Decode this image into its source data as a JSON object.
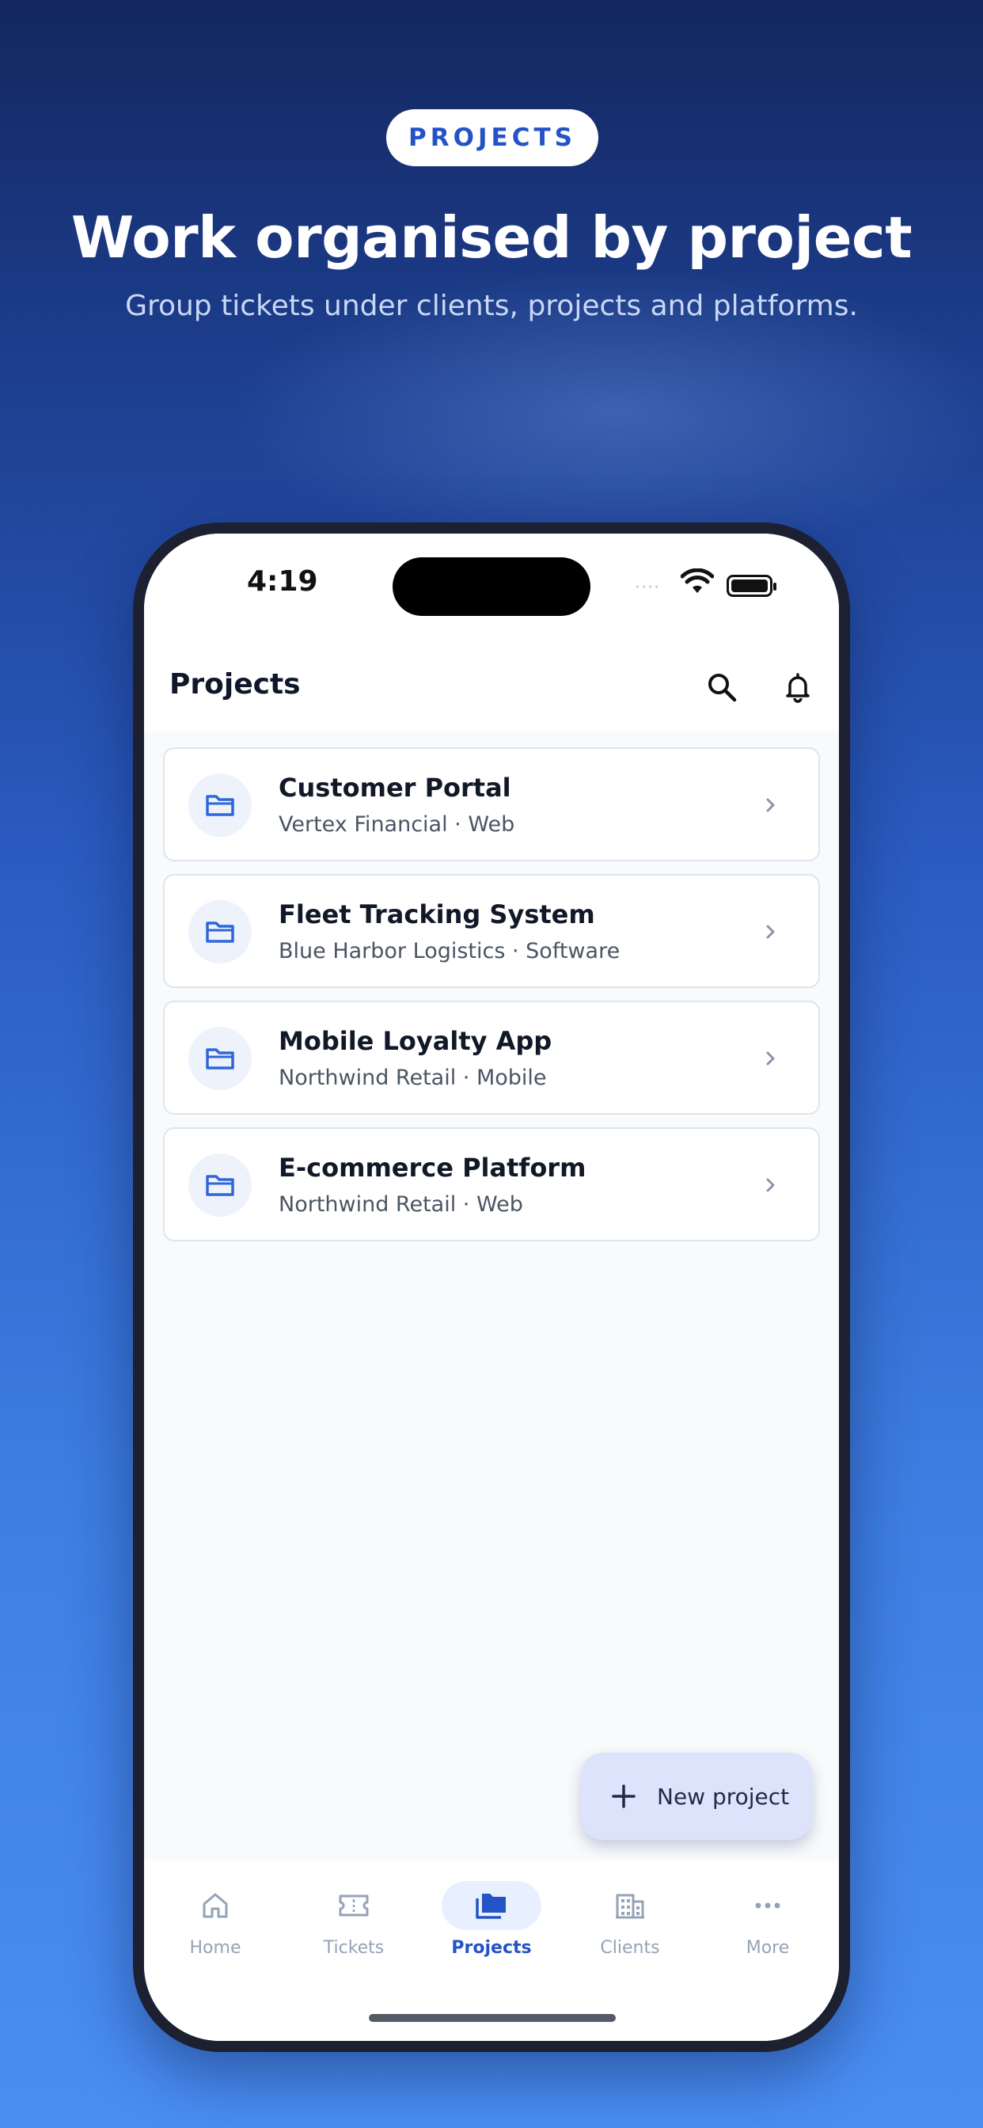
{
  "promo": {
    "badge": "PROJECTS",
    "headline": "Work organised by project",
    "subhead": "Group tickets under clients, projects and platforms."
  },
  "status_bar": {
    "time": "4:19",
    "signal": "····"
  },
  "app_bar": {
    "title": "Projects",
    "icons": [
      "search-icon",
      "bell-icon"
    ]
  },
  "projects": [
    {
      "name": "Customer Portal",
      "meta": "Vertex Financial · Web"
    },
    {
      "name": "Fleet Tracking System",
      "meta": "Blue Harbor Logistics · Software"
    },
    {
      "name": "Mobile Loyalty App",
      "meta": "Northwind Retail · Mobile"
    },
    {
      "name": "E-commerce Platform",
      "meta": "Northwind Retail · Web"
    }
  ],
  "fab": {
    "label": "New project"
  },
  "tabs": [
    {
      "label": "Home",
      "icon": "home-icon"
    },
    {
      "label": "Tickets",
      "icon": "ticket-icon"
    },
    {
      "label": "Projects",
      "icon": "folder-stack-icon",
      "active": true
    },
    {
      "label": "Clients",
      "icon": "building-icon"
    },
    {
      "label": "More",
      "icon": "more-icon"
    }
  ],
  "colors": {
    "accent": "#2453c7",
    "background_top": "#14275f",
    "background_bottom": "#4a8ef4",
    "fab_bg": "#dde3fb"
  }
}
